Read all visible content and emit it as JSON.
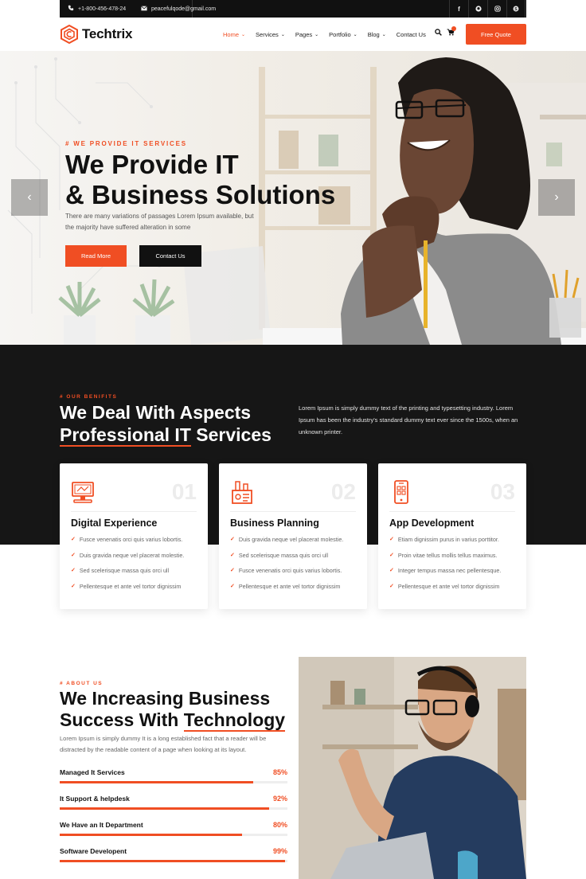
{
  "topbar": {
    "phone": "+1-800-456-478-24",
    "email": "peacefulqode@gmail.com",
    "social_icons": [
      "facebook-icon",
      "github-icon",
      "instagram-icon",
      "skype-icon"
    ]
  },
  "nav": {
    "logo_text": "Techtrix",
    "items": [
      {
        "label": "Home",
        "active": true,
        "dropdown": true
      },
      {
        "label": "Services",
        "active": false,
        "dropdown": true
      },
      {
        "label": "Pages",
        "active": false,
        "dropdown": true
      },
      {
        "label": "Portfolio",
        "active": false,
        "dropdown": true
      },
      {
        "label": "Blog",
        "active": false,
        "dropdown": true
      },
      {
        "label": "Contact Us",
        "active": false,
        "dropdown": false
      }
    ],
    "cta": "Free Quote"
  },
  "hero": {
    "eyebrow": "# WE PROVIDE IT SERVICES",
    "title_line1": "We Provide IT",
    "title_line2": "& Business Solutions",
    "text_line1": "There are many variations of passages Lorem Ipsum available, but",
    "text_line2": "the majority have suffered alteration in some",
    "primary_button": "Read More",
    "secondary_button": "Contact Us"
  },
  "benefits": {
    "eyebrow": "# OUR BENIFITS",
    "title_line1": "We Deal With Aspects",
    "title_line2_highlight": "Professional IT",
    "title_line2_rest": " Services",
    "text": "Lorem Ipsum is simply dummy text of the printing and typesetting industry. Lorem Ipsum has been the industry's standard dummy text ever since the 1500s, when an unknown printer.",
    "cards": [
      {
        "number": "01",
        "title": "Digital Experience",
        "icon": "monitor-icon",
        "items": [
          "Fusce venenatis orci quis varius lobortis.",
          "Duis gravida neque vel placerat molestie.",
          "Sed scelerisque massa quis orci ull",
          "Pellentesque et ante vel tortor dignissim"
        ]
      },
      {
        "number": "02",
        "title": "Business Planning",
        "icon": "planning-icon",
        "items": [
          "Duis gravida neque vel placerat molestie.",
          "Sed scelerisque massa quis orci ull",
          "Fusce venenatis orci quis varius lobortis.",
          "Pellentesque et ante vel tortor dignissim"
        ]
      },
      {
        "number": "03",
        "title": "App Development",
        "icon": "mobile-app-icon",
        "items": [
          "Etiam dignissim purus in varius porttitor.",
          "Proin vitae tellus mollis tellus maximus.",
          "Integer tempus massa nec pellentesque.",
          "Pellentesque et ante vel tortor dignissim"
        ]
      }
    ]
  },
  "about": {
    "eyebrow": "# ABOUT US",
    "title_line1": "We Increasing Business",
    "title_line2_prefix": "Success With ",
    "title_line2_highlight": "Technology",
    "text": "Lorem Ipsum is simply dummy It is a long established fact that a reader will be distracted by the readable content of a page when looking at its layout.",
    "skills": [
      {
        "label": "Managed It Services",
        "percent_text": "85%",
        "value": 85
      },
      {
        "label": "It Support & helpdesk",
        "percent_text": "92%",
        "value": 92
      },
      {
        "label": "We Have an It Department",
        "percent_text": "80%",
        "value": 80
      },
      {
        "label": "Software Developent",
        "percent_text": "99%",
        "value": 99
      }
    ]
  },
  "colors": {
    "accent": "#f04e23",
    "dark": "#161616"
  }
}
